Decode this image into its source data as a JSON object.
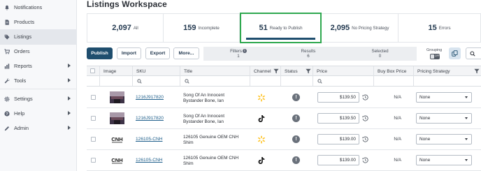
{
  "sidebar": {
    "items": [
      {
        "label": "Notifications",
        "icon": "bell-icon"
      },
      {
        "label": "Products",
        "icon": "document-icon"
      },
      {
        "label": "Listings",
        "icon": "tag-icon",
        "active": true
      },
      {
        "label": "Orders",
        "icon": "cart-icon"
      },
      {
        "label": "Reports",
        "icon": "chart-icon",
        "expandable": true
      },
      {
        "label": "Tools",
        "icon": "wrench-icon",
        "expandable": true
      },
      {
        "label": "Settings",
        "icon": "gear-icon",
        "expandable": true
      },
      {
        "label": "Help",
        "icon": "question-icon",
        "expandable": true
      },
      {
        "label": "Admin",
        "icon": "pencil-icon",
        "expandable": true
      }
    ]
  },
  "header": {
    "title": "Listings Workspace"
  },
  "stats": [
    {
      "count": "2,097",
      "label": "All"
    },
    {
      "count": "159",
      "label": "Incomplete"
    },
    {
      "count": "51",
      "label": "Ready to Publish",
      "selected": true
    },
    {
      "count": "2,095",
      "label": "No Pricing Strategy"
    },
    {
      "count": "15",
      "label": "Errors"
    }
  ],
  "toolbar": {
    "publish": "Publish",
    "import": "Import",
    "export": "Export",
    "more": "More...",
    "filters_label": "Filters",
    "filters_value": "1",
    "results_label": "Results",
    "results_value": "6",
    "selected_label": "Selected",
    "selected_value": "0",
    "grouping_label": "Grouping",
    "grouping_state": "OFF"
  },
  "table": {
    "columns": [
      "Image",
      "SKU",
      "Title",
      "Channel",
      "Status",
      "Price",
      "Buy Box Price",
      "Pricing Strategy"
    ],
    "rows": [
      {
        "image": "book-cover",
        "sku": "1216J917820",
        "title": "Song Of An Innocent Bystander Bone, Ian",
        "channel": "walmart",
        "status_icon": "alert-icon",
        "price": "$139.50",
        "buy_box": "N/A",
        "strategy": "None"
      },
      {
        "image": "book-cover",
        "sku": "1216J917820",
        "title": "Song Of An Innocent Bystander Bone, Ian",
        "channel": "tiktok",
        "status_icon": "alert-icon",
        "price": "$139.50",
        "buy_box": "N/A",
        "strategy": "None"
      },
      {
        "image": "cnh-logo",
        "sku": "126105-CNH",
        "title": "126105 Genuine OEM CNH Shim",
        "channel": "walmart",
        "status_icon": "alert-icon",
        "price": "$139.00",
        "buy_box": "N/A",
        "strategy": "None"
      },
      {
        "image": "cnh-logo",
        "sku": "126105-CNH",
        "title": "126105 Genuine OEM CNH Shim",
        "channel": "tiktok",
        "status_icon": "alert-icon",
        "price": "$139.00",
        "buy_box": "N/A",
        "strategy": "None"
      }
    ]
  },
  "colors": {
    "primary": "#1f4e6e",
    "selected_border": "#2fa84f",
    "link": "#1f5f8b",
    "walmart": "#ffc220"
  }
}
